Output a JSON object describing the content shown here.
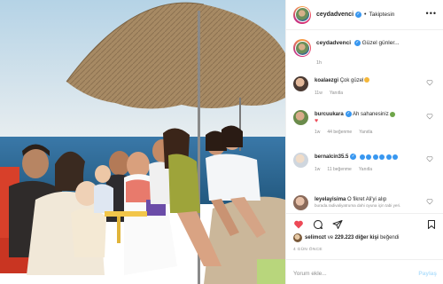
{
  "photo": {
    "description_colors": {
      "sky": "#cfe2ec",
      "sea": "#2f6f9f",
      "sand": "#cbb79a",
      "umbrella": "#a88c67"
    }
  },
  "header": {
    "username": "ceydadvenci",
    "separator": "•",
    "follow_status": "Takiptesin",
    "more": "•••"
  },
  "caption": {
    "username": "ceydadvenci",
    "text": "Güzel günler...",
    "time": "1h"
  },
  "comments": [
    {
      "username": "koalaezgi",
      "text": "Çok güzel",
      "meta": [
        "11w",
        "Yanıtla"
      ]
    },
    {
      "username": "burcuukara",
      "text": "Ah sahanesiniz",
      "meta": [
        "1w",
        "44 beğenme",
        "Yanıtla"
      ]
    },
    {
      "username": "bernalcin35.5",
      "text": "",
      "meta": [
        "1w",
        "11 beğenme",
        "Yanıtla"
      ]
    },
    {
      "username": "leyelayisima",
      "text": "O fikret Ali'yi alıp",
      "sub": "burada.radivaliyatruma dahi oyuna için tabi yeri.",
      "meta": []
    }
  ],
  "likes": {
    "avatar_user": "selimozt",
    "text_pre": "ve",
    "count": "229.223 diğer kişi",
    "text_post": "beğendi"
  },
  "ago": "4 GÜN ÖNCE",
  "add_comment": {
    "placeholder": "Yorum ekle...",
    "post": "Paylaş"
  },
  "colors": {
    "accent": "#3897f0",
    "like_red": "#ed4956",
    "muted": "#8e8e8e",
    "text": "#262626"
  }
}
